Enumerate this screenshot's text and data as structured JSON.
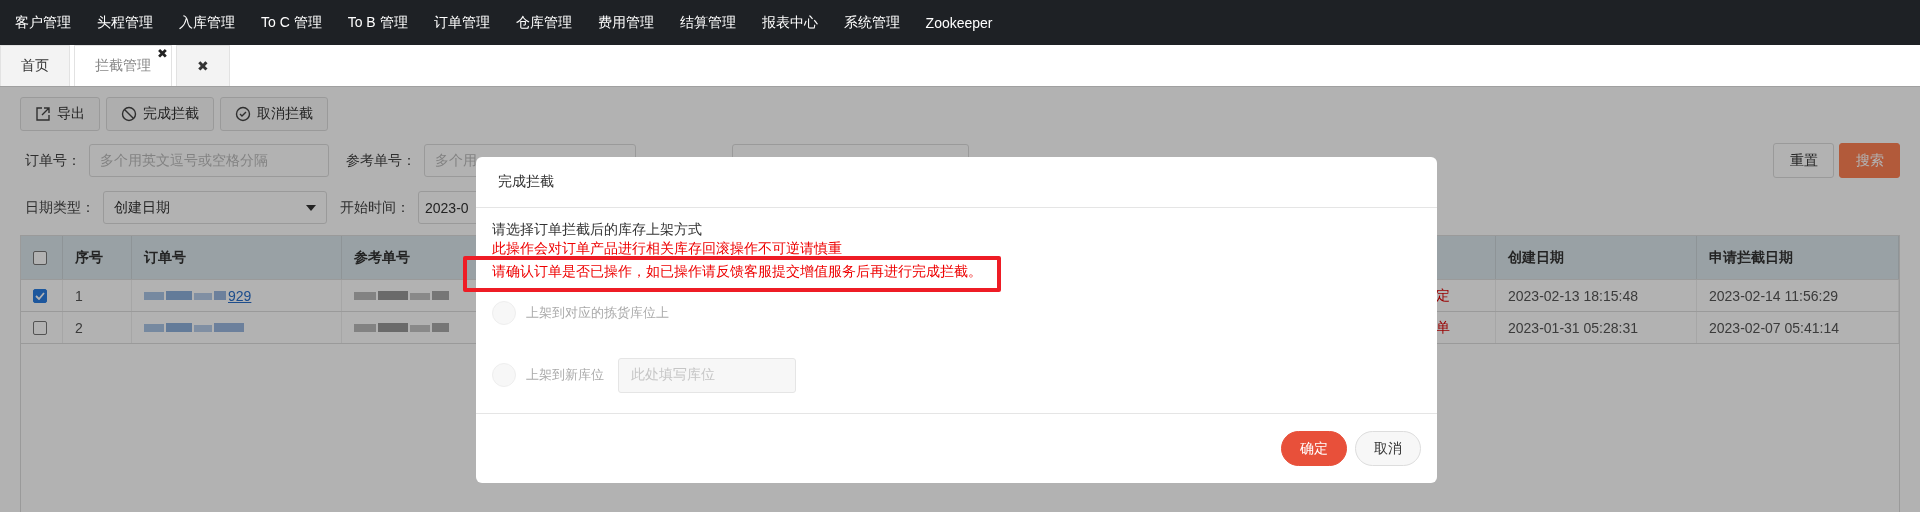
{
  "nav": {
    "items": [
      "客户管理",
      "头程管理",
      "入库管理",
      "To C 管理",
      "To B 管理",
      "订单管理",
      "仓库管理",
      "费用管理",
      "结算管理",
      "报表中心",
      "系统管理",
      "Zookeeper"
    ]
  },
  "tabs": [
    {
      "label": "首页",
      "selected": false
    },
    {
      "label": "拦截管理",
      "selected": true,
      "close": "✖"
    },
    {
      "label": "✖",
      "selected": false
    }
  ],
  "toolbar": [
    {
      "label": "导出",
      "kind": "export"
    },
    {
      "label": "完成拦截",
      "kind": "ban"
    },
    {
      "label": "取消拦截",
      "kind": "check"
    }
  ],
  "filters": {
    "row_1": [
      {
        "kind": "input",
        "label": "订单号：",
        "placeholder": "多个用英文逗号或空格分隔"
      },
      {
        "kind": "input",
        "label": "参考单号：",
        "placeholder": "多个用"
      },
      {
        "kind": "input"
      }
    ],
    "row_2": [
      {
        "kind": "select",
        "label": "日期类型：",
        "value": "创建日期"
      },
      {
        "kind": "input",
        "label": "开始时间：",
        "value": "2023-0"
      }
    ],
    "actions": [
      {
        "label": "重置",
        "primary": false
      },
      {
        "label": "搜索",
        "primary": true
      }
    ]
  },
  "table": {
    "header_checked": false,
    "columns_left": [
      "序号",
      "订单号",
      "参考单号"
    ],
    "columns_right": [
      "创建日期",
      "申请拦截日期"
    ],
    "rows": [
      {
        "checked": true,
        "seq": "1",
        "order_tail": "929",
        "status": "定",
        "created": "2023-02-13 18:15:48",
        "requested": "2023-02-14 11:56:29"
      },
      {
        "checked": false,
        "seq": "2",
        "status": "单",
        "created": "2023-01-31 05:28:31",
        "requested": "2023-02-07 05:41:14"
      }
    ]
  },
  "dialog": {
    "title": "完成拦截",
    "prompt": "请选择订单拦截后的库存上架方式",
    "warning": "此操作会对订单产品进行相关库存回滚操作不可逆请慎重",
    "notice": "请确认订单是否已操作，如已操作请反馈客服提交增值服务后再进行完成拦截。",
    "options": [
      {
        "label": "上架到对应的拣货库位上",
        "selected": false,
        "disabled": true
      },
      {
        "label": "上架到新库位",
        "selected": false,
        "disabled": true,
        "placeholder": "此处填写库位"
      }
    ],
    "buttons": [
      {
        "label": "确定",
        "primary": true
      },
      {
        "label": "取消",
        "primary": false
      }
    ]
  }
}
